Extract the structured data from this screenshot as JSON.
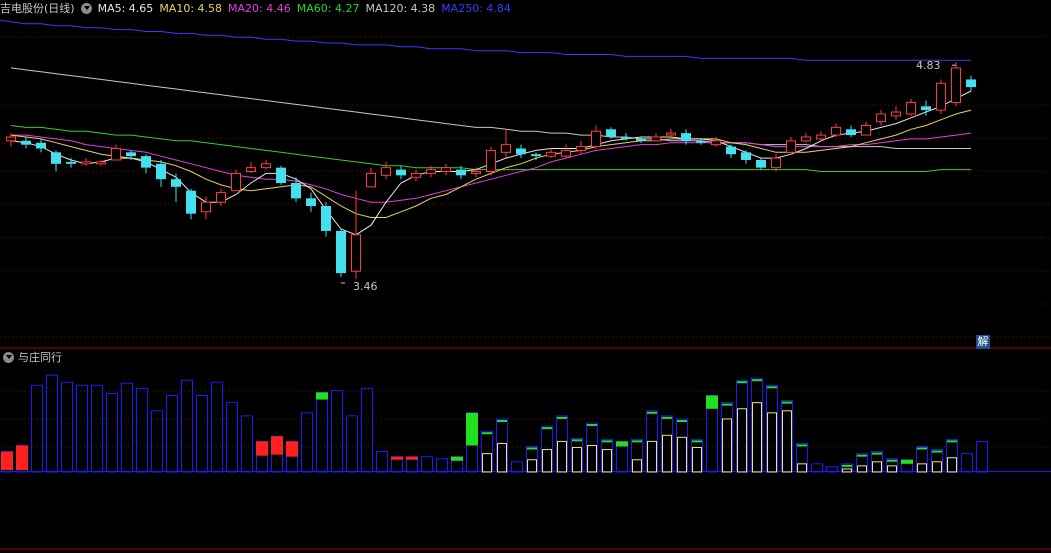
{
  "header": {
    "stock_name": "吉电股份(日线)",
    "ma": [
      {
        "label": "MA5: 4.65",
        "color": "#e6e6e6"
      },
      {
        "label": "MA10: 4.58",
        "color": "#e6d35a"
      },
      {
        "label": "MA20: 4.46",
        "color": "#e040e0"
      },
      {
        "label": "MA60: 4.27",
        "color": "#30d030"
      },
      {
        "label": "MA120: 4.38",
        "color": "#c8c8c8"
      },
      {
        "label": "MA250: 4.84",
        "color": "#3a3aff"
      }
    ]
  },
  "indicator": {
    "name": "与庄同行"
  },
  "badge": {
    "text": "解"
  },
  "colors": {
    "up": "#ff3b3b",
    "down": "#45e0ee",
    "ma5": "#e6e6e6",
    "ma10": "#e6d35a",
    "ma20": "#e040e0",
    "ma60": "#30d030",
    "ma120": "#c8c8c8",
    "ma250": "#3a3aff",
    "bar_outline": "#1a1aff",
    "bar_yellow": "#f0e860",
    "bar_red": "#ff2020",
    "bar_green": "#20e020",
    "grid": "#7a0000"
  },
  "chart_data": {
    "type": "candlestick",
    "price_range": [
      3.35,
      5.05
    ],
    "high_label": "4.83",
    "low_label": "3.46",
    "candles": [
      [
        4.42,
        4.44,
        4.46,
        4.39
      ],
      [
        4.42,
        4.4,
        4.44,
        4.38
      ],
      [
        4.41,
        4.38,
        4.43,
        4.36
      ],
      [
        4.36,
        4.3,
        4.37,
        4.26
      ],
      [
        4.31,
        4.3,
        4.33,
        4.28
      ],
      [
        4.3,
        4.31,
        4.33,
        4.29
      ],
      [
        4.3,
        4.31,
        4.32,
        4.29
      ],
      [
        4.32,
        4.38,
        4.4,
        4.32
      ],
      [
        4.36,
        4.34,
        4.37,
        4.32
      ],
      [
        4.34,
        4.28,
        4.35,
        4.25
      ],
      [
        4.3,
        4.22,
        4.32,
        4.18
      ],
      [
        4.22,
        4.18,
        4.25,
        4.1
      ],
      [
        4.16,
        4.04,
        4.17,
        4.01
      ],
      [
        4.05,
        4.1,
        4.13,
        4.01
      ],
      [
        4.1,
        4.15,
        4.17,
        4.08
      ],
      [
        4.16,
        4.25,
        4.27,
        4.16
      ],
      [
        4.26,
        4.28,
        4.31,
        4.25
      ],
      [
        4.28,
        4.3,
        4.32,
        4.27
      ],
      [
        4.28,
        4.2,
        4.29,
        4.19
      ],
      [
        4.2,
        4.12,
        4.23,
        4.1
      ],
      [
        4.12,
        4.08,
        4.15,
        4.05
      ],
      [
        4.08,
        3.95,
        4.1,
        3.92
      ],
      [
        3.95,
        3.73,
        3.96,
        3.71
      ],
      [
        3.74,
        3.93,
        4.16,
        3.7
      ],
      [
        4.18,
        4.25,
        4.28,
        4.18
      ],
      [
        4.24,
        4.28,
        4.31,
        4.22
      ],
      [
        4.27,
        4.24,
        4.29,
        4.22
      ],
      [
        4.23,
        4.25,
        4.27,
        4.21
      ],
      [
        4.25,
        4.27,
        4.29,
        4.23
      ],
      [
        4.26,
        4.28,
        4.3,
        4.24
      ],
      [
        4.27,
        4.24,
        4.29,
        4.22
      ],
      [
        4.25,
        4.26,
        4.28,
        4.23
      ],
      [
        4.26,
        4.37,
        4.39,
        4.24
      ],
      [
        4.36,
        4.4,
        4.48,
        4.33
      ],
      [
        4.38,
        4.35,
        4.4,
        4.33
      ],
      [
        4.35,
        4.34,
        4.36,
        4.32
      ],
      [
        4.34,
        4.36,
        4.38,
        4.33
      ],
      [
        4.34,
        4.37,
        4.4,
        4.33
      ],
      [
        4.37,
        4.39,
        4.42,
        4.35
      ],
      [
        4.39,
        4.47,
        4.5,
        4.38
      ],
      [
        4.48,
        4.44,
        4.49,
        4.43
      ],
      [
        4.44,
        4.43,
        4.46,
        4.42
      ],
      [
        4.43,
        4.42,
        4.44,
        4.41
      ],
      [
        4.42,
        4.44,
        4.46,
        4.42
      ],
      [
        4.45,
        4.46,
        4.48,
        4.44
      ],
      [
        4.46,
        4.42,
        4.48,
        4.4
      ],
      [
        4.42,
        4.41,
        4.43,
        4.4
      ],
      [
        4.4,
        4.42,
        4.44,
        4.39
      ],
      [
        4.39,
        4.35,
        4.4,
        4.33
      ],
      [
        4.36,
        4.32,
        4.37,
        4.3
      ],
      [
        4.32,
        4.28,
        4.33,
        4.27
      ],
      [
        4.28,
        4.33,
        4.35,
        4.26
      ],
      [
        4.36,
        4.42,
        4.44,
        4.36
      ],
      [
        4.42,
        4.44,
        4.46,
        4.41
      ],
      [
        4.43,
        4.45,
        4.47,
        4.42
      ],
      [
        4.45,
        4.49,
        4.51,
        4.44
      ],
      [
        4.48,
        4.45,
        4.5,
        4.44
      ],
      [
        4.45,
        4.5,
        4.52,
        4.45
      ],
      [
        4.52,
        4.56,
        4.58,
        4.5
      ],
      [
        4.55,
        4.57,
        4.6,
        4.53
      ],
      [
        4.56,
        4.62,
        4.64,
        4.55
      ],
      [
        4.6,
        4.58,
        4.63,
        4.55
      ],
      [
        4.58,
        4.72,
        4.74,
        4.56
      ],
      [
        4.62,
        4.8,
        4.83,
        4.6
      ],
      [
        4.74,
        4.7,
        4.76,
        4.68
      ]
    ],
    "ma5": [
      4.42,
      4.41,
      4.39,
      4.35,
      4.32,
      4.3,
      4.31,
      4.33,
      4.33,
      4.31,
      4.27,
      4.23,
      4.15,
      4.1,
      4.1,
      4.14,
      4.2,
      4.25,
      4.25,
      4.22,
      4.17,
      4.06,
      3.96,
      3.93,
      3.98,
      4.1,
      4.2,
      4.24,
      4.26,
      4.26,
      4.26,
      4.27,
      4.3,
      4.33,
      4.35,
      4.37,
      4.38,
      4.38,
      4.38,
      4.4,
      4.42,
      4.43,
      4.44,
      4.44,
      4.44,
      4.43,
      4.43,
      4.42,
      4.39,
      4.36,
      4.33,
      4.33,
      4.35,
      4.38,
      4.42,
      4.45,
      4.46,
      4.47,
      4.49,
      4.51,
      4.54,
      4.57,
      4.6,
      4.64,
      4.68
    ],
    "ma10": [
      4.45,
      4.44,
      4.43,
      4.41,
      4.39,
      4.37,
      4.35,
      4.34,
      4.33,
      4.32,
      4.31,
      4.29,
      4.26,
      4.22,
      4.19,
      4.17,
      4.16,
      4.17,
      4.18,
      4.19,
      4.18,
      4.13,
      4.08,
      4.04,
      4.02,
      4.02,
      4.05,
      4.08,
      4.12,
      4.14,
      4.18,
      4.22,
      4.25,
      4.28,
      4.3,
      4.33,
      4.35,
      4.36,
      4.37,
      4.39,
      4.4,
      4.41,
      4.42,
      4.42,
      4.43,
      4.43,
      4.43,
      4.43,
      4.41,
      4.4,
      4.38,
      4.36,
      4.36,
      4.36,
      4.37,
      4.38,
      4.39,
      4.41,
      4.43,
      4.45,
      4.48,
      4.5,
      4.53,
      4.56,
      4.58
    ],
    "ma20": [
      4.45,
      4.45,
      4.44,
      4.43,
      4.42,
      4.4,
      4.39,
      4.38,
      4.37,
      4.36,
      4.34,
      4.32,
      4.3,
      4.28,
      4.26,
      4.24,
      4.23,
      4.22,
      4.22,
      4.21,
      4.19,
      4.17,
      4.14,
      4.12,
      4.1,
      4.1,
      4.11,
      4.12,
      4.14,
      4.16,
      4.18,
      4.2,
      4.22,
      4.24,
      4.26,
      4.28,
      4.31,
      4.33,
      4.35,
      4.37,
      4.38,
      4.39,
      4.4,
      4.4,
      4.41,
      4.41,
      4.41,
      4.41,
      4.41,
      4.41,
      4.4,
      4.39,
      4.39,
      4.39,
      4.39,
      4.39,
      4.4,
      4.4,
      4.41,
      4.42,
      4.43,
      4.43,
      4.44,
      4.45,
      4.46
    ],
    "ma60": [
      4.5,
      4.49,
      4.49,
      4.48,
      4.47,
      4.47,
      4.46,
      4.45,
      4.45,
      4.44,
      4.43,
      4.42,
      4.42,
      4.41,
      4.4,
      4.39,
      4.38,
      4.37,
      4.36,
      4.35,
      4.34,
      4.33,
      4.32,
      4.31,
      4.3,
      4.29,
      4.29,
      4.28,
      4.28,
      4.28,
      4.28,
      4.27,
      4.27,
      4.27,
      4.27,
      4.27,
      4.27,
      4.27,
      4.27,
      4.27,
      4.27,
      4.27,
      4.27,
      4.27,
      4.27,
      4.27,
      4.27,
      4.27,
      4.27,
      4.27,
      4.27,
      4.27,
      4.27,
      4.27,
      4.26,
      4.26,
      4.26,
      4.26,
      4.26,
      4.26,
      4.26,
      4.26,
      4.27,
      4.27,
      4.27
    ],
    "ma120": [
      4.8,
      4.79,
      4.78,
      4.77,
      4.76,
      4.75,
      4.74,
      4.73,
      4.72,
      4.71,
      4.7,
      4.69,
      4.68,
      4.67,
      4.66,
      4.65,
      4.64,
      4.63,
      4.62,
      4.61,
      4.6,
      4.59,
      4.58,
      4.57,
      4.56,
      4.55,
      4.54,
      4.53,
      4.52,
      4.51,
      4.5,
      4.49,
      4.49,
      4.48,
      4.47,
      4.47,
      4.46,
      4.46,
      4.45,
      4.45,
      4.44,
      4.44,
      4.43,
      4.43,
      4.42,
      4.42,
      4.42,
      4.41,
      4.41,
      4.41,
      4.4,
      4.4,
      4.4,
      4.4,
      4.39,
      4.39,
      4.39,
      4.39,
      4.39,
      4.38,
      4.38,
      4.38,
      4.38,
      4.38,
      4.38
    ],
    "ma250": [
      5.04,
      5.03,
      5.03,
      5.02,
      5.02,
      5.01,
      5.01,
      5.0,
      5.0,
      4.99,
      4.99,
      4.98,
      4.98,
      4.97,
      4.97,
      4.96,
      4.96,
      4.95,
      4.95,
      4.94,
      4.94,
      4.93,
      4.93,
      4.92,
      4.92,
      4.92,
      4.91,
      4.91,
      4.9,
      4.9,
      4.9,
      4.89,
      4.89,
      4.89,
      4.88,
      4.88,
      4.88,
      4.87,
      4.87,
      4.87,
      4.87,
      4.86,
      4.86,
      4.86,
      4.86,
      4.86,
      4.85,
      4.85,
      4.85,
      4.85,
      4.85,
      4.85,
      4.85,
      4.84,
      4.84,
      4.84,
      4.84,
      4.84,
      4.84,
      4.84,
      4.84,
      4.84,
      4.84,
      4.84,
      4.84
    ],
    "indicator_max": 100,
    "indicator_bars": [
      [
        20,
        "red",
        18
      ],
      [
        26,
        "red",
        24
      ],
      [
        85,
        "blue",
        0
      ],
      [
        95,
        "blue",
        0
      ],
      [
        88,
        "blue",
        0
      ],
      [
        85,
        "blue",
        0
      ],
      [
        85,
        "blue",
        0
      ],
      [
        77,
        "blue",
        0
      ],
      [
        87,
        "blue",
        0
      ],
      [
        82,
        "blue",
        0
      ],
      [
        60,
        "blue",
        0
      ],
      [
        75,
        "blue",
        0
      ],
      [
        90,
        "blue",
        0
      ],
      [
        75,
        "blue",
        0
      ],
      [
        88,
        "blue",
        0
      ],
      [
        68,
        "blue",
        0
      ],
      [
        55,
        "blue",
        0
      ],
      [
        30,
        "red",
        14
      ],
      [
        35,
        "red",
        18
      ],
      [
        30,
        "red",
        15
      ],
      [
        58,
        "blue",
        0
      ],
      [
        78,
        "green",
        7
      ],
      [
        80,
        "blue",
        0
      ],
      [
        55,
        "blue",
        0
      ],
      [
        82,
        "blue",
        0
      ],
      [
        20,
        "blue",
        0
      ],
      [
        15,
        "red",
        3
      ],
      [
        15,
        "red",
        3
      ],
      [
        15,
        "blue",
        0
      ],
      [
        13,
        "blue",
        0
      ],
      [
        15,
        "green",
        4
      ],
      [
        58,
        "green",
        32
      ],
      [
        40,
        "yellow",
        18
      ],
      [
        52,
        "yellow",
        28
      ],
      [
        10,
        "blue",
        0
      ],
      [
        25,
        "yellow",
        12
      ],
      [
        45,
        "yellow",
        22
      ],
      [
        55,
        "yellow",
        30
      ],
      [
        33,
        "yellow",
        24
      ],
      [
        48,
        "yellow",
        26
      ],
      [
        32,
        "yellow",
        22
      ],
      [
        30,
        "green",
        5
      ],
      [
        32,
        "yellow",
        12
      ],
      [
        60,
        "yellow",
        30
      ],
      [
        55,
        "yellow",
        36
      ],
      [
        52,
        "yellow",
        34
      ],
      [
        32,
        "yellow",
        24
      ],
      [
        75,
        "green",
        13
      ],
      [
        68,
        "yellow",
        52
      ],
      [
        90,
        "yellow",
        62
      ],
      [
        92,
        "yellow",
        68
      ],
      [
        85,
        "yellow",
        58
      ],
      [
        70,
        "yellow",
        60
      ],
      [
        28,
        "yellow",
        8
      ],
      [
        8,
        "blue",
        0
      ],
      [
        5,
        "blue",
        0
      ],
      [
        8,
        "yellow",
        3
      ],
      [
        18,
        "yellow",
        6
      ],
      [
        20,
        "yellow",
        10
      ],
      [
        13,
        "yellow",
        6
      ],
      [
        12,
        "green",
        4
      ],
      [
        25,
        "yellow",
        8
      ],
      [
        22,
        "yellow",
        10
      ],
      [
        32,
        "yellow",
        14
      ],
      [
        18,
        "blue",
        0
      ],
      [
        30,
        "blue",
        0
      ]
    ]
  }
}
